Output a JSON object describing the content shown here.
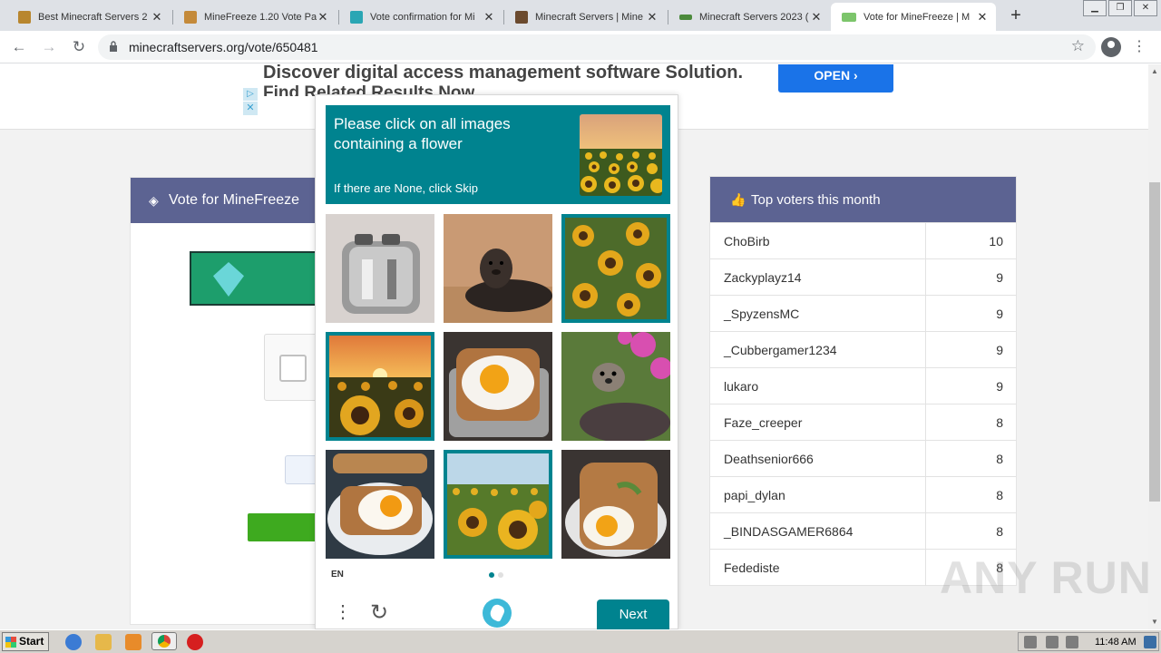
{
  "browser": {
    "tabs": [
      {
        "title": "Best Minecraft Servers 2",
        "favicon_color": "#b8862e"
      },
      {
        "title": "MineFreeze 1.20 Vote Pa",
        "favicon_color": "#c48a3a"
      },
      {
        "title": "Vote confirmation for Mi",
        "favicon_color": "#2aa6b4"
      },
      {
        "title": "Minecraft Servers | Mine",
        "favicon_color": "#6b4a2e"
      },
      {
        "title": "Minecraft Servers 2023 (",
        "favicon_color": "#4c8a3c"
      },
      {
        "title": "Vote for MineFreeze | M",
        "favicon_color": "#7cc56b"
      }
    ],
    "url": "minecraftservers.org/vote/650481"
  },
  "ad": {
    "line1": "Discover digital access management software Solution.",
    "line2": "Find Related Results Now",
    "button": "OPEN"
  },
  "vote_panel": {
    "title": "Vote for MineFreeze"
  },
  "top_voters": {
    "title": "Top voters this month",
    "rows": [
      {
        "name": "ChoBirb",
        "votes": "10"
      },
      {
        "name": "Zackyplayz14",
        "votes": "9"
      },
      {
        "name": "_SpyzensMC",
        "votes": "9"
      },
      {
        "name": "_Cubbergamer1234",
        "votes": "9"
      },
      {
        "name": "lukaro",
        "votes": "9"
      },
      {
        "name": "Faze_creeper",
        "votes": "8"
      },
      {
        "name": "Deathsenior666",
        "votes": "8"
      },
      {
        "name": "papi_dylan",
        "votes": "8"
      },
      {
        "name": "_BINDASGAMER6864",
        "votes": "8"
      },
      {
        "name": "Fedediste",
        "votes": "8"
      }
    ]
  },
  "captcha": {
    "prompt": "Please click on all images containing a flower",
    "hint": "If there are None, click Skip",
    "language": "EN",
    "next_label": "Next",
    "accent": "#00838f",
    "tiles": [
      {
        "subject": "toaster",
        "selected": false
      },
      {
        "subject": "seal",
        "selected": false
      },
      {
        "subject": "sunflowers",
        "selected": true
      },
      {
        "subject": "sunflower-field-sunset",
        "selected": true
      },
      {
        "subject": "fried-egg-toast",
        "selected": false
      },
      {
        "subject": "otter-flowers",
        "selected": false
      },
      {
        "subject": "egg-toast-plate",
        "selected": false
      },
      {
        "subject": "sunflower-field",
        "selected": true
      },
      {
        "subject": "egg-toast",
        "selected": false
      }
    ]
  },
  "watermark": "ANY RUN",
  "taskbar": {
    "start_label": "Start",
    "clock": "11:48 AM"
  }
}
